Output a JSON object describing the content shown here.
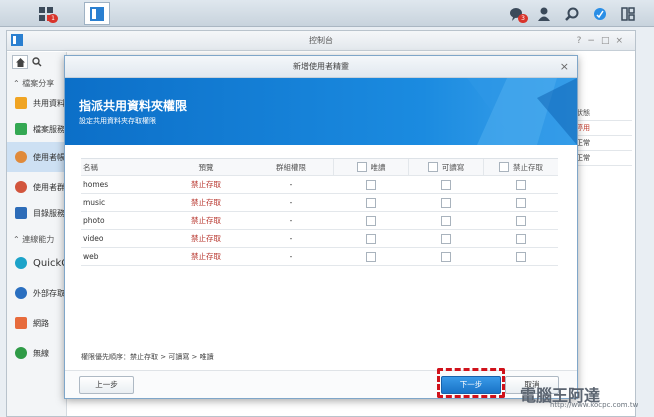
{
  "control_panel": {
    "title": "控制台"
  },
  "sidebar": {
    "sections": [
      {
        "label": "檔案分享"
      },
      {
        "label": "連線能力"
      }
    ],
    "items": [
      {
        "label": "共用資料夾"
      },
      {
        "label": "檔案服務"
      },
      {
        "label": "使用者帳號"
      },
      {
        "label": "使用者群組"
      },
      {
        "label": "目錄服務"
      },
      {
        "label": "QuickConnect"
      },
      {
        "label": "外部存取"
      },
      {
        "label": "網路"
      },
      {
        "label": "無線"
      }
    ]
  },
  "background_list": {
    "header": "狀態",
    "rows": [
      "停用",
      "正常",
      "正常"
    ]
  },
  "dialog": {
    "title": "新增使用者精靈",
    "close": "×",
    "banner_title": "指派共用資料夾權限",
    "banner_subtitle": "設定共用資料夾存取權限",
    "columns": {
      "name": "名稱",
      "preview": "預覽",
      "group_permission": "群組權限",
      "read_only": "唯讀",
      "read_write": "可讀寫",
      "no_access": "禁止存取"
    },
    "rows": [
      {
        "name": "homes",
        "preview": "禁止存取",
        "group": "-"
      },
      {
        "name": "music",
        "preview": "禁止存取",
        "group": "-"
      },
      {
        "name": "photo",
        "preview": "禁止存取",
        "group": "-"
      },
      {
        "name": "video",
        "preview": "禁止存取",
        "group": "-"
      },
      {
        "name": "web",
        "preview": "禁止存取",
        "group": "-"
      }
    ],
    "priority_note": "權限優先順序：禁止存取 > 可讀寫 > 唯讀",
    "buttons": {
      "prev": "上一步",
      "next": "下一步",
      "cancel": "取消"
    }
  },
  "taskbar": {
    "badge_main": "1",
    "badge_chat": "3"
  },
  "watermark": {
    "text": "電腦王阿達",
    "url": "http://www.kocpc.com.tw"
  },
  "colors": {
    "accent": "#1873c7",
    "banner": "#0c6fc8",
    "deny_text": "#b7342c",
    "highlight": "#d0121b"
  }
}
